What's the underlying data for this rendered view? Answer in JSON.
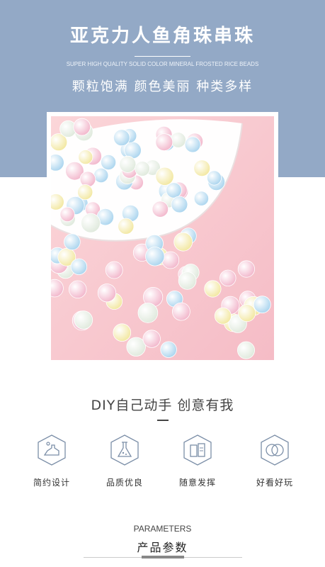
{
  "hero": {
    "title": "亚克力人鱼角珠串珠",
    "subtitle": "SUPER HIGH QUALITY SOLID COLOR MINERAL FROSTED RICE BEADS",
    "tagline": "颗粒饱满 颜色美丽 种类多样"
  },
  "product_photo": {
    "subject": "frosted pastel beads",
    "bead_colors": [
      "#f7c7d6",
      "#bfe0f2",
      "#f8f0b8",
      "#e8eff6",
      "#f5d2e4"
    ],
    "background_color": "#f7c9cf"
  },
  "slogan": "DIY自己动手 创意有我",
  "features": [
    {
      "icon": "craft-icon",
      "label": "简约设计"
    },
    {
      "icon": "flask-icon",
      "label": "品质优良"
    },
    {
      "icon": "palette-icon",
      "label": "随意发挥"
    },
    {
      "icon": "rings-icon",
      "label": "好看好玩"
    }
  ],
  "parameters": {
    "title_en": "PARAMETERS",
    "title_cn": "产品参数"
  }
}
